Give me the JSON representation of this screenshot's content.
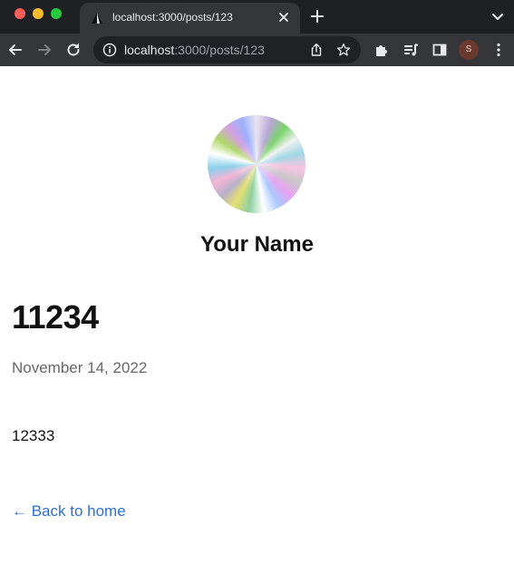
{
  "browser": {
    "tab": {
      "title": "localhost:3000/posts/123",
      "close_icon": "close-icon",
      "favicon": "triangle-favicon"
    },
    "new_tab_icon": "plus-icon",
    "tab_dropdown_icon": "chevron-down-icon",
    "toolbar": {
      "back_icon": "arrow-left-icon",
      "forward_icon": "arrow-right-icon",
      "reload_icon": "reload-icon",
      "omnibox": {
        "info_icon": "info-icon",
        "url_host": "localhost",
        "url_rest": ":3000/posts/123",
        "share_icon": "share-icon",
        "star_icon": "star-icon"
      },
      "extensions_icon": "puzzle-icon",
      "media_icon": "media-queue-icon",
      "sidepanel_icon": "side-panel-icon",
      "profile_initial": "S",
      "menu_icon": "kebab-menu-icon"
    }
  },
  "page": {
    "author_name": "Your Name",
    "post_title": "11234",
    "post_date": "November 14, 2022",
    "post_body": "12333",
    "back_link": "← Back to home"
  },
  "colors": {
    "tab_bg": "#35363a",
    "tabstrip_bg": "#1f2023",
    "omnibox_bg": "#202124",
    "link": "#2b6fd6",
    "date_text": "#666666"
  }
}
